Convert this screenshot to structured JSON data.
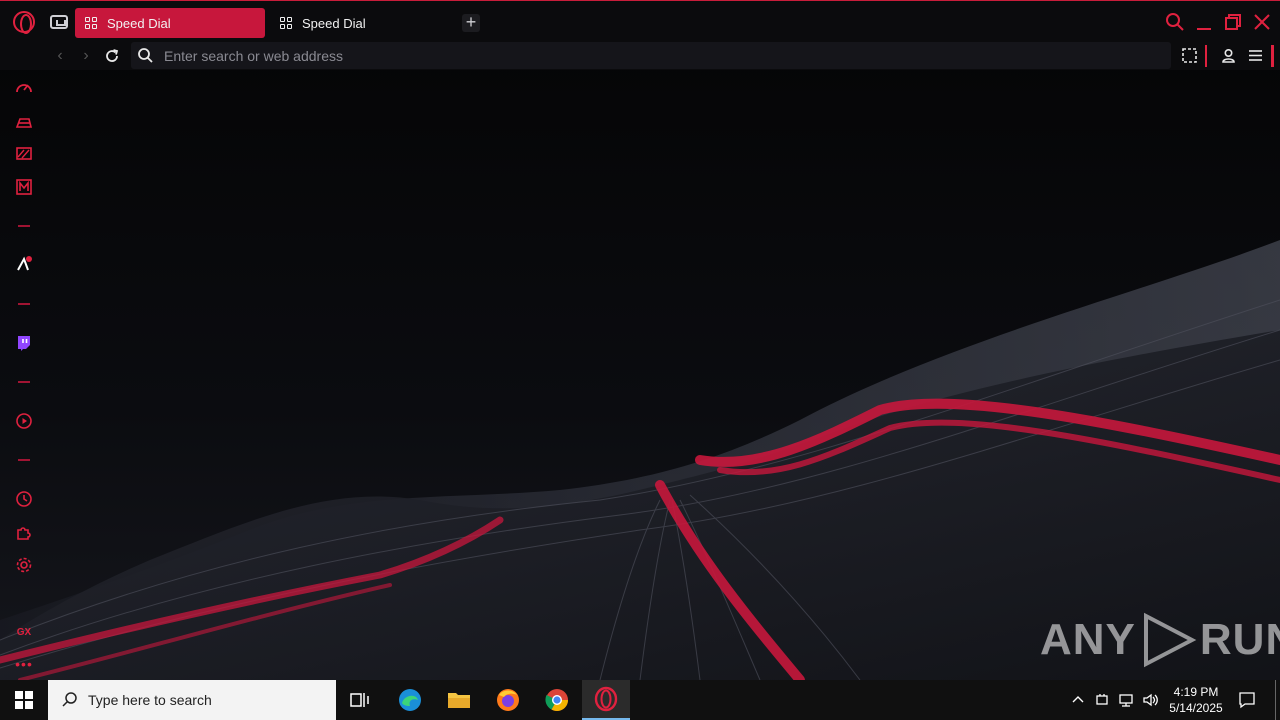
{
  "tabs": [
    {
      "label": "Speed Dial",
      "active": true
    },
    {
      "label": "Speed Dial",
      "active": false
    }
  ],
  "address_bar": {
    "placeholder": "Enter search or web address",
    "value": ""
  },
  "sidebar": {
    "items": [
      "speed-icon",
      "shopping-icon",
      "stripes-icon",
      "gx-mail-icon",
      "paint-icon",
      "twitch-icon",
      "player-icon",
      "history-icon",
      "extensions-icon",
      "settings-icon",
      "gx-icon",
      "more-icon"
    ],
    "gx_label": "GX"
  },
  "taskbar": {
    "search_placeholder": "Type here to search",
    "time": "4:19 PM",
    "date": "5/14/2025"
  },
  "watermark": {
    "text_left": "ANY",
    "text_right": "RUN"
  },
  "colors": {
    "accent": "#e0213f",
    "tab_active": "#c7173c",
    "background": "#050506"
  }
}
